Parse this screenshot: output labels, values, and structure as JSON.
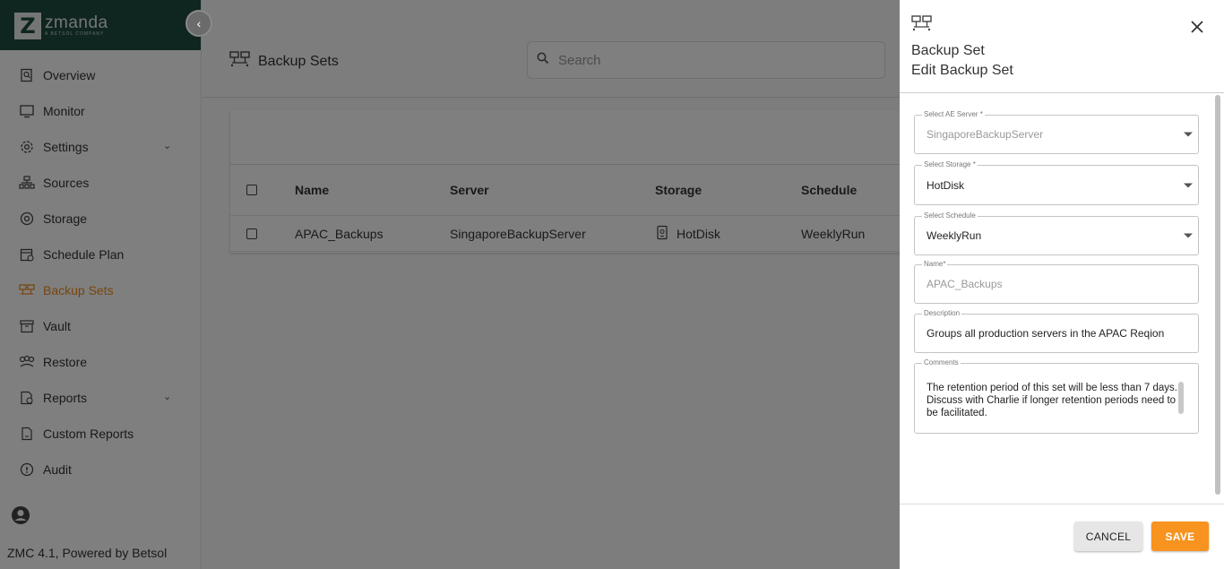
{
  "brand": {
    "name": "zmanda",
    "tagline": "A BETSOL COMPANY",
    "logo_letter": "Z"
  },
  "sidebar": {
    "collapse_icon": "chevron-left-icon",
    "items": [
      {
        "label": "Overview",
        "icon": "overview-icon"
      },
      {
        "label": "Monitor",
        "icon": "monitor-icon"
      },
      {
        "label": "Settings",
        "icon": "gear-icon",
        "expandable": true
      },
      {
        "label": "Sources",
        "icon": "sources-icon"
      },
      {
        "label": "Storage",
        "icon": "storage-icon"
      },
      {
        "label": "Schedule Plan",
        "icon": "calendar-icon"
      },
      {
        "label": "Backup Sets",
        "icon": "backup-sets-icon",
        "active": true
      },
      {
        "label": "Vault",
        "icon": "vault-icon"
      },
      {
        "label": "Restore",
        "icon": "restore-icon"
      },
      {
        "label": "Reports",
        "icon": "reports-icon",
        "expandable": true
      },
      {
        "label": "Custom Reports",
        "icon": "custom-reports-icon"
      },
      {
        "label": "Audit",
        "icon": "info-icon"
      }
    ],
    "footer": "ZMC 4.1, Powered by Betsol"
  },
  "main": {
    "title": "Backup Sets",
    "search": {
      "placeholder": "Search"
    },
    "table": {
      "columns": [
        "Name",
        "Server",
        "Storage",
        "Schedule"
      ],
      "rows": [
        {
          "name": "APAC_Backups",
          "server": "SingaporeBackupServer",
          "storage": "HotDisk",
          "schedule": "WeeklyRun"
        }
      ]
    }
  },
  "drawer": {
    "title": "Backup Set",
    "subtitle": "Edit Backup Set",
    "fields": {
      "ae_server": {
        "label": "Select AE Server *",
        "value": "SingaporeBackupServer"
      },
      "storage": {
        "label": "Select Storage *",
        "value": "HotDisk"
      },
      "schedule": {
        "label": "Select Schedule",
        "value": "WeeklyRun"
      },
      "name": {
        "label": "Name*",
        "value": "APAC_Backups"
      },
      "description": {
        "label": "Description",
        "value": "Groups all production servers in the APAC Reqion"
      },
      "comments": {
        "label": "Comments",
        "value": "The retention period of this set will be less than 7 days. Discuss with Charlie if longer retention periods need to be facilitated."
      }
    },
    "cancel_label": "CANCEL",
    "save_label": "SAVE"
  },
  "colors": {
    "accent": "#f7931e",
    "brand_bg": "#1f4a40",
    "active_nav": "#f08a1c"
  }
}
